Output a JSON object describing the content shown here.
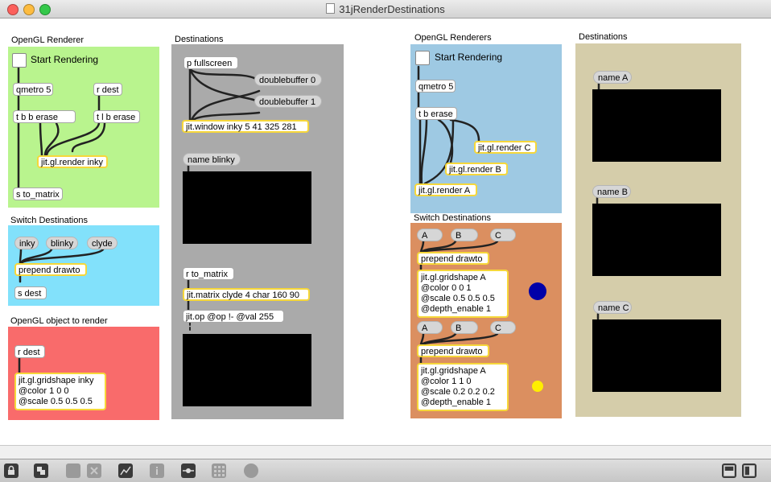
{
  "window": {
    "title": "31jRenderDestinations"
  },
  "left": {
    "renderer_title": "OpenGL Renderer",
    "start_rendering": "Start Rendering",
    "qmetro": "qmetro 5",
    "rdest": "r dest",
    "tbberase": "t b b erase",
    "tlberase": "t l b erase",
    "render": "jit.gl.render inky",
    "sto_matrix": "s to_matrix",
    "switch_title": "Switch Destinations",
    "msg_inky": "inky",
    "msg_blinky": "blinky",
    "msg_clyde": "clyde",
    "prepend": "prepend drawto",
    "sdest": "s dest",
    "object_title": "OpenGL object to render",
    "rdest2": "r dest",
    "gridshape_lines": [
      "jit.gl.gridshape inky",
      "@color 1 0 0",
      "@scale 0.5 0.5 0.5"
    ]
  },
  "destinations1": {
    "title": "Destinations",
    "pfullscreen": "p fullscreen",
    "db0": "doublebuffer 0",
    "db1": "doublebuffer 1",
    "window": "jit.window inky 5 41 325 281",
    "name_blinky": "name blinky",
    "rto_matrix": "r to_matrix",
    "matrix": "jit.matrix clyde 4 char 160 90",
    "op": "jit.op @op !- @val 255"
  },
  "right": {
    "renderers_title": "OpenGL Renderers",
    "start_rendering": "Start Rendering",
    "qmetro": "qmetro 5",
    "terase": "t b erase",
    "renderC": "jit.gl.render C",
    "renderB": "jit.gl.render B",
    "renderA": "jit.gl.render A",
    "switch_title": "Switch Destinations",
    "msgs1": [
      "A",
      "B",
      "C"
    ],
    "prepend1": "prepend drawto",
    "grid1_lines": [
      "jit.gl.gridshape A",
      "@color 0 0 1",
      "@scale 0.5 0.5 0.5",
      "@depth_enable 1"
    ],
    "msgs2": [
      "A",
      "B",
      "C"
    ],
    "prepend2": "prepend drawto",
    "grid2_lines": [
      "jit.gl.gridshape A",
      "@color 1 1 0",
      "@scale 0.2 0.2 0.2",
      "@depth_enable 1"
    ]
  },
  "destinations2": {
    "title": "Destinations",
    "nameA": "name A",
    "nameB": "name B",
    "nameC": "name C"
  },
  "colors": {
    "green_panel": "#b9f48e",
    "cyan_panel": "#82e1fb",
    "red_panel": "#f96b6b",
    "gray_panel": "#aaaaaa",
    "blue_panel": "#9ec9e3",
    "orange_panel": "#db8f60",
    "tan_panel": "#d5cdaa",
    "blue_dot": "#0000a8",
    "yellow_dot": "#ffee00"
  },
  "toolbar": {
    "icons": [
      "lock-icon",
      "presentation-icon",
      "patcher-icon",
      "close-icon",
      "chart-icon",
      "info-icon",
      "slider-icon",
      "grid-icon",
      "record-icon",
      "split-left-icon",
      "split-right-icon"
    ]
  }
}
